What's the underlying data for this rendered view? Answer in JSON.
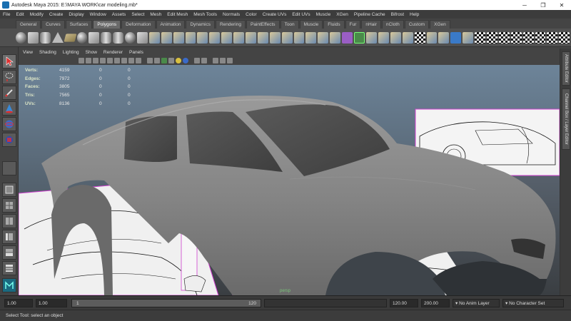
{
  "window": {
    "title": "Autodesk Maya 2015: E:\\MAYA WORK\\car modeling.mb*",
    "controls": [
      "─",
      "❐",
      "✕"
    ]
  },
  "menubar": [
    "File",
    "Edit",
    "Modify",
    "Create",
    "Display",
    "Window",
    "Assets",
    "Select",
    "Mesh",
    "Edit Mesh",
    "Mesh Tools",
    "Normals",
    "Color",
    "Create UVs",
    "Edit UVs",
    "Muscle",
    "XGen",
    "Pipeline Cache",
    "Bifrost",
    "Help"
  ],
  "shelf_tabs": [
    "General",
    "Curves",
    "Surfaces",
    "Polygons",
    "Deformation",
    "Animation",
    "Dynamics",
    "Rendering",
    "PaintEffects",
    "Toon",
    "Muscle",
    "Fluids",
    "Fur",
    "nHair",
    "nCloth",
    "Custom",
    "XGen"
  ],
  "shelf_active": "Polygons",
  "shelf_icons": [
    "sphere",
    "cube",
    "cylinder",
    "cone",
    "plane",
    "torus",
    "prism",
    "pipe",
    "helix",
    "soccer-ball",
    "platonic",
    "combine",
    "separate",
    "extract",
    "booleans",
    "smooth",
    "average",
    "fill-hole",
    "triangulate",
    "quadrangulate",
    "extrude",
    "bridge",
    "append",
    "split",
    "insert-loop",
    "offset-loop",
    "slide-edge",
    "pipe-sel",
    "tool-green",
    "mirror",
    "cut",
    "merge",
    "snap",
    "checker-uv",
    "planar",
    "cylindrical",
    "spherical",
    "auto-uv",
    "checker-a",
    "checker-b",
    "checker-c",
    "checker-d",
    "checker-e",
    "checker-f",
    "checker-g",
    "checker-h"
  ],
  "panel_menu": [
    "View",
    "Shading",
    "Lighting",
    "Show",
    "Renderer",
    "Panels"
  ],
  "hud": {
    "rows": [
      {
        "label": "Verts:",
        "v1": "4159",
        "v2": "0",
        "v3": "0"
      },
      {
        "label": "Edges:",
        "v1": "7972",
        "v2": "0",
        "v3": "0"
      },
      {
        "label": "Faces:",
        "v1": "3805",
        "v2": "0",
        "v3": "0"
      },
      {
        "label": "Tris:",
        "v1": "7565",
        "v2": "0",
        "v3": "0"
      },
      {
        "label": "UVs:",
        "v1": "8136",
        "v2": "0",
        "v3": "0"
      }
    ]
  },
  "camera_label": "persp",
  "right_tabs": [
    "Attribute Editor",
    "Channel Box / Layer Editor"
  ],
  "timebar": {
    "start_time": "1.00",
    "playback_start": "1.00",
    "current_frame": "1",
    "range_start": "1",
    "range_end": "120",
    "playback_end": "120.00",
    "end_time": "200.00",
    "anim_layer": "No Anim Layer",
    "character_set": "No Character Set"
  },
  "helpline": "Select Tool: select an object",
  "colors": {
    "viewport_top": "#6d8499",
    "viewport_bottom": "#3b4044",
    "car_body": "#8a8a8a",
    "hud_label": "#dfe8c8",
    "active_shelf_tab": "#6a6a6a"
  }
}
